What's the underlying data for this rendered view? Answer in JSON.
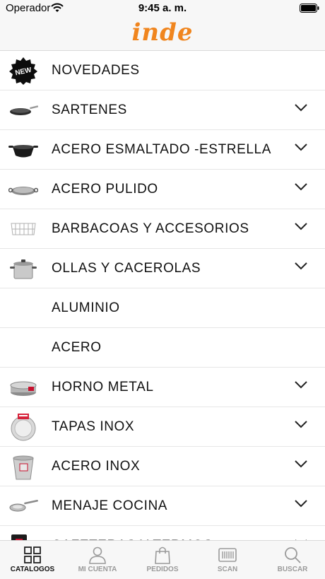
{
  "status_bar": {
    "carrier": "Operador",
    "time": "9:45 a. m."
  },
  "header": {
    "logo_text": "inde",
    "brand_color": "#f0851e"
  },
  "categories": [
    {
      "label": "NOVEDADES",
      "icon": "new-badge-icon",
      "expandable": false
    },
    {
      "label": "SARTENES",
      "icon": "frying-pan-icon",
      "expandable": true
    },
    {
      "label": "ACERO ESMALTADO -ESTRELLA",
      "icon": "enamel-pan-icon",
      "expandable": true
    },
    {
      "label": "ACERO PULIDO",
      "icon": "paella-pan-icon",
      "expandable": true
    },
    {
      "label": "BARBACOAS Y ACCESORIOS",
      "icon": "grill-icon",
      "expandable": true
    },
    {
      "label": "OLLAS Y CACEROLAS",
      "icon": "pot-icon",
      "expandable": true
    },
    {
      "label": "ALUMINIO",
      "icon": "",
      "expandable": false
    },
    {
      "label": "ACERO",
      "icon": "",
      "expandable": false
    },
    {
      "label": "HORNO METAL",
      "icon": "cake-mold-icon",
      "expandable": true
    },
    {
      "label": "TAPAS INOX",
      "icon": "lid-icon",
      "expandable": true
    },
    {
      "label": "ACERO INOX",
      "icon": "bucket-icon",
      "expandable": true
    },
    {
      "label": "MENAJE COCINA",
      "icon": "skimmer-icon",
      "expandable": true
    },
    {
      "label": "CAFETERAS Y TERMOS",
      "icon": "coffee-maker-icon",
      "expandable": true
    }
  ],
  "tabs": [
    {
      "label": "CATALOGOS",
      "icon": "grid-icon",
      "active": true
    },
    {
      "label": "MI CUENTA",
      "icon": "user-icon",
      "active": false
    },
    {
      "label": "PEDIDOS",
      "icon": "bag-icon",
      "active": false
    },
    {
      "label": "SCAN",
      "icon": "barcode-icon",
      "active": false
    },
    {
      "label": "BUSCAR",
      "icon": "search-icon",
      "active": false
    }
  ]
}
